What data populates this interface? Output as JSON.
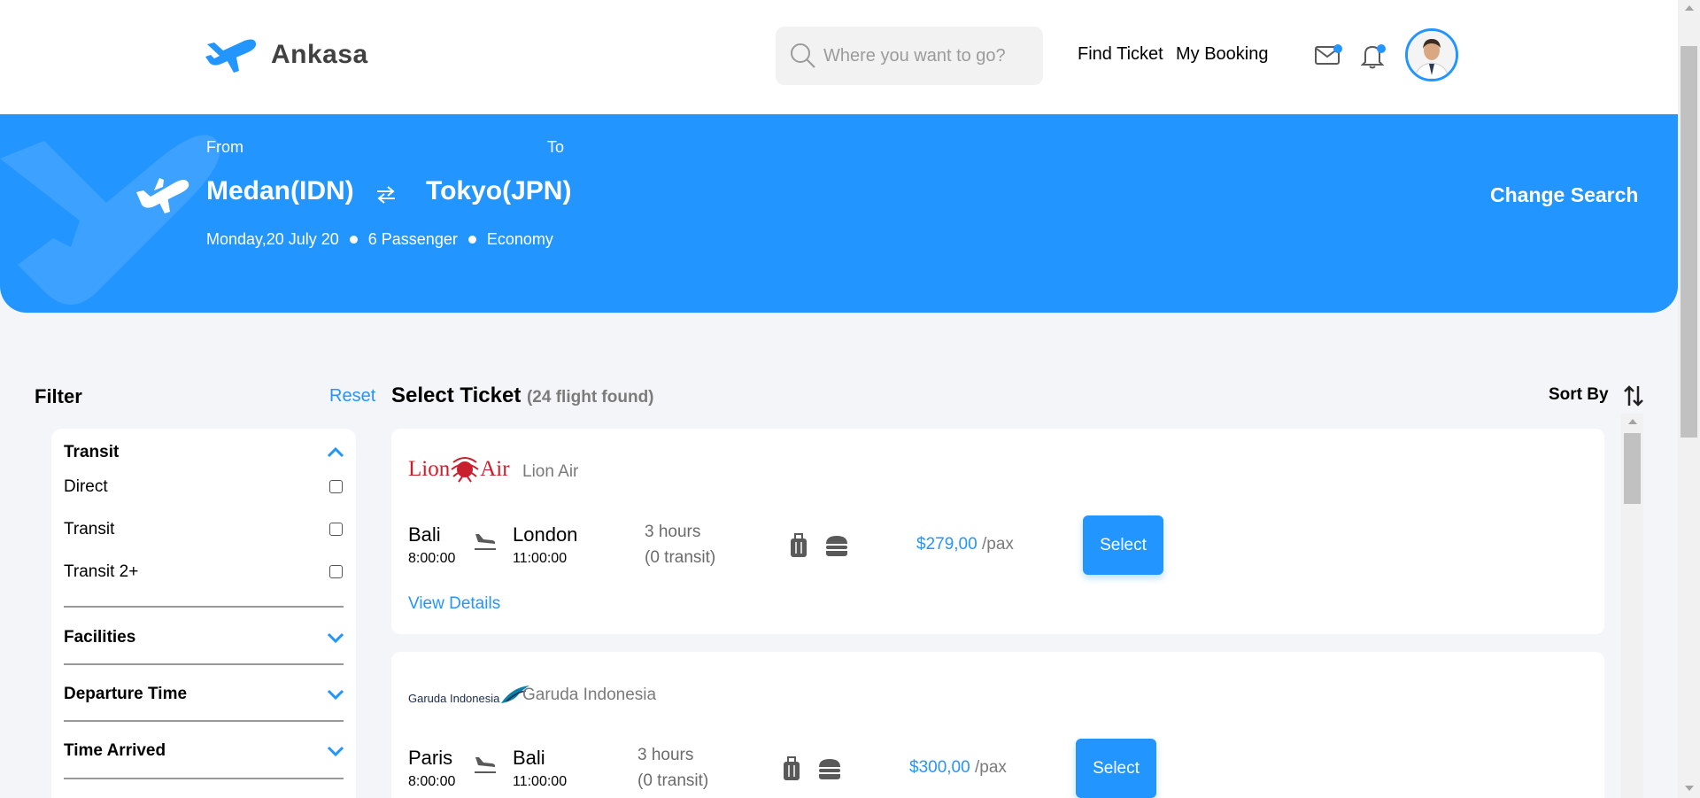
{
  "brand": {
    "name": "Ankasa",
    "accent": "#2395ff"
  },
  "nav": {
    "search_placeholder": "Where you want to go?",
    "find_ticket": "Find Ticket",
    "my_booking": "My Booking",
    "icons": [
      "search-icon",
      "mail-icon",
      "bell-icon"
    ]
  },
  "banner": {
    "from_label": "From",
    "to_label": "To",
    "from_city": "Medan(IDN)",
    "to_city": "Tokyo(JPN)",
    "date": "Monday,20 July 20",
    "passengers": "6 Passenger",
    "class": "Economy",
    "change_search": "Change Search"
  },
  "filter": {
    "title": "Filter",
    "reset": "Reset",
    "transit": {
      "title": "Transit",
      "options": [
        {
          "label": "Direct",
          "checked": false
        },
        {
          "label": "Transit",
          "checked": false
        },
        {
          "label": "Transit 2+",
          "checked": false
        }
      ]
    },
    "facilities": "Facilities",
    "departure_time": "Departure Time",
    "time_arrived": "Time Arrived"
  },
  "tickets": {
    "title": "Select Ticket",
    "count": "(24 flight found)",
    "sort_by": "Sort By",
    "items": [
      {
        "logo_text": "Lion Air",
        "airline": "Lion Air",
        "from": "Bali",
        "depart": "8:00:00",
        "to": "London",
        "arrive": "11:00:00",
        "duration": "3 hours",
        "transit": "(0 transit)",
        "price": "$279,00",
        "per": "/pax",
        "select": "Select",
        "details": "View Details"
      },
      {
        "logo_text": "Garuda Indonesia",
        "airline": "Garuda Indonesia",
        "from": "Paris",
        "depart": "8:00:00",
        "to": "Bali",
        "arrive": "11:00:00",
        "duration": "3 hours",
        "transit": "(0 transit)",
        "price": "$300,00",
        "per": "/pax",
        "select": "Select"
      }
    ]
  }
}
